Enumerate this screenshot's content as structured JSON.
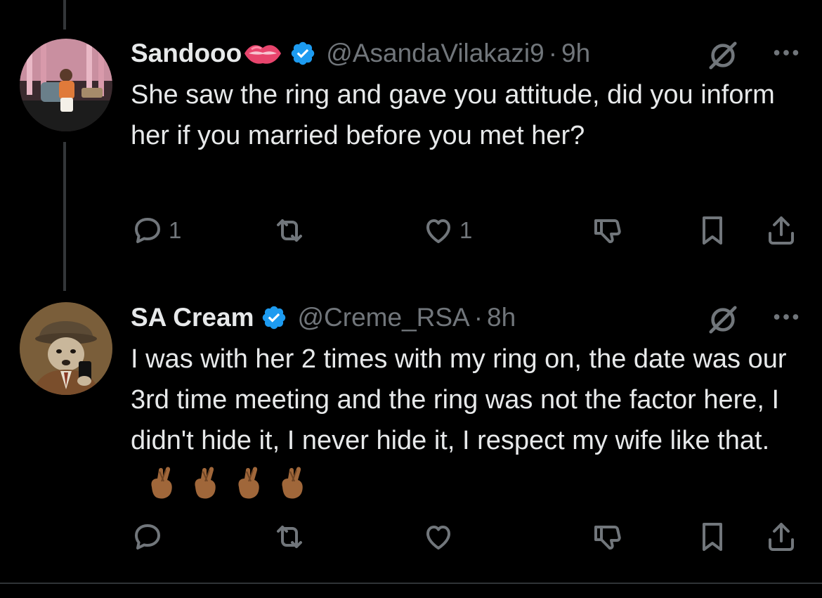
{
  "colors": {
    "background": "#000000",
    "text": "#e7e9ea",
    "muted": "#71767b",
    "verified": "#1d9bf0",
    "thread_line": "#333639"
  },
  "tweets": [
    {
      "display_name": "Sandooo",
      "name_emoji": "lips-emoji",
      "verified": true,
      "handle": "@AsandaVilakazi9",
      "separator": "·",
      "time": "9h",
      "text": "She saw the ring and gave you attitude, did you inform her if you married before you met her?",
      "actions": {
        "reply_count": "1",
        "repost_count": "",
        "like_count": "1"
      },
      "icons": [
        "grok-icon",
        "more-icon",
        "reply-icon",
        "repost-icon",
        "like-icon",
        "downvote-icon",
        "bookmark-icon",
        "share-icon"
      ]
    },
    {
      "display_name": "SA Cream",
      "verified": true,
      "handle": "@Creme_RSA",
      "separator": "·",
      "time": "8h",
      "text": "I was with her 2  times with my ring on, the date was our 3rd time meeting and the ring was not the factor here, I didn't hide it, I never hide it, I respect my wife like that.",
      "text_emoji": [
        "crossed-fingers-emoji",
        "crossed-fingers-emoji",
        "crossed-fingers-emoji",
        "crossed-fingers-emoji"
      ],
      "actions": {
        "reply_count": "",
        "repost_count": "",
        "like_count": ""
      },
      "icons": [
        "grok-icon",
        "more-icon",
        "reply-icon",
        "repost-icon",
        "like-icon",
        "downvote-icon",
        "bookmark-icon",
        "share-icon"
      ]
    }
  ]
}
